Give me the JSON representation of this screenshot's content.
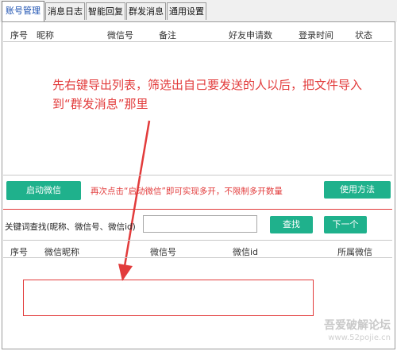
{
  "tabs": [
    {
      "label": "账号管理",
      "active": true
    },
    {
      "label": "消息日志"
    },
    {
      "label": "智能回复"
    },
    {
      "label": "群发消息"
    },
    {
      "label": "通用设置"
    }
  ],
  "top_table": {
    "columns": [
      "序号",
      "昵称",
      "微信号",
      "备注",
      "好友申请数",
      "登录时间",
      "状态"
    ]
  },
  "annotation_top": "先右键导出列表，筛选出自己要发送的人以后，把文件导入到“群发消息”那里",
  "start_button": "启动微信",
  "annotation_mid": "再次点击“启动微信”即可实现多开，不限制多开数量",
  "help_button": "使用方法",
  "search": {
    "label": "关键词查找(昵称、微信号、微信id)",
    "value": "",
    "find_button": "查找",
    "next_button": "下一个"
  },
  "bottom_table": {
    "columns": [
      "序号",
      "微信昵称",
      "微信号",
      "微信id",
      "所属微信"
    ]
  },
  "watermark": {
    "line1": "吾爱破解论坛",
    "line2": "www.52pojie.cn"
  },
  "colors": {
    "accent": "#1fb18c",
    "annotation": "#e23b3b",
    "active_tab_text": "#1a4fb0"
  }
}
